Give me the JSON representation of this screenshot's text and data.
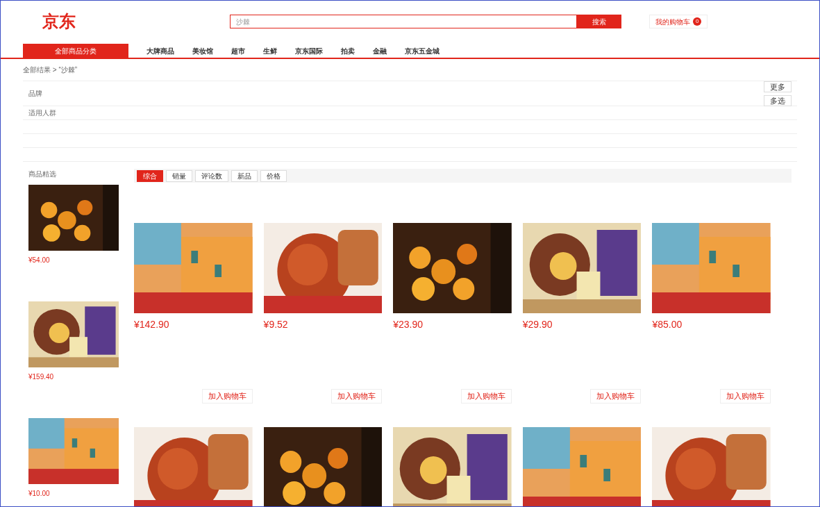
{
  "header": {
    "logo": "京东",
    "search": {
      "value": "沙棘"
    },
    "search_button": "搜索",
    "cart": {
      "label": "我的购物车",
      "count": "0"
    }
  },
  "nav": [
    {
      "label": "全部商品分类",
      "selected": true
    },
    {
      "label": "大牌商品",
      "selected": false
    },
    {
      "label": "美妆馆",
      "selected": false
    },
    {
      "label": "超市",
      "selected": false
    },
    {
      "label": "生鲜",
      "selected": false
    },
    {
      "label": "京东国际",
      "selected": false
    },
    {
      "label": "拍卖",
      "selected": false
    },
    {
      "label": "金融",
      "selected": false
    },
    {
      "label": "京东五金城",
      "selected": false
    }
  ],
  "breadcrumb": "全部结果 > “沙棘”",
  "filters": [
    {
      "label": "品牌"
    },
    {
      "label": "适用人群"
    }
  ],
  "filter_buttons": [
    "更多",
    "多选"
  ],
  "sort_tabs": [
    {
      "label": "综合",
      "selected": true
    },
    {
      "label": "销量",
      "selected": false
    },
    {
      "label": "评论数",
      "selected": false
    },
    {
      "label": "新品",
      "selected": false
    },
    {
      "label": "价格",
      "selected": false
    }
  ],
  "sidebar": {
    "title": "商品精选",
    "items": [
      {
        "price": "¥54.00"
      },
      {
        "price": "¥159.40"
      },
      {
        "price": "¥10.00"
      }
    ]
  },
  "products": [
    {
      "price": "¥142.90",
      "cart_button": "加入购物车"
    },
    {
      "price": "¥9.52",
      "cart_button": "加入购物车"
    },
    {
      "price": "¥23.90",
      "cart_button": "加入购物车"
    },
    {
      "price": "¥29.90",
      "cart_button": "加入购物车"
    },
    {
      "price": "¥85.00",
      "cart_button": "加入购物车"
    }
  ],
  "second_row": [
    {
      "kind": "picture"
    },
    {
      "kind": "picture"
    },
    {
      "kind": "picture"
    },
    {
      "kind": "picture"
    },
    {
      "kind": "picture"
    }
  ]
}
